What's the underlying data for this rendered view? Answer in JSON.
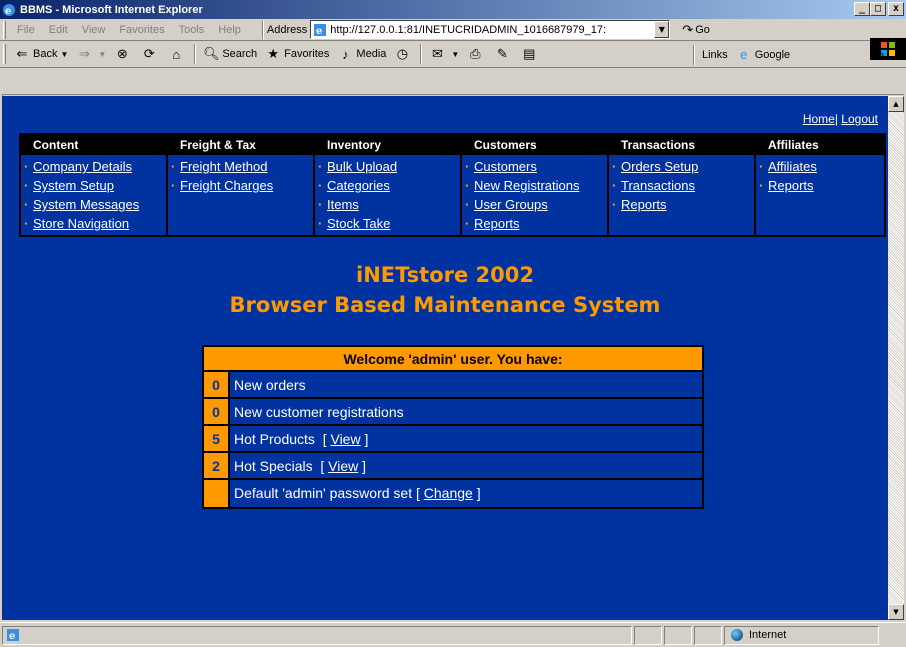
{
  "window": {
    "title": "BBMS - Microsoft Internet Explorer"
  },
  "menu": [
    "File",
    "Edit",
    "View",
    "Favorites",
    "Tools",
    "Help"
  ],
  "address": {
    "label": "Address",
    "url": "http://127.0.0.1:81/INETUCRIDADMIN_1016687979_17:"
  },
  "go_label": "Go",
  "toolbar": {
    "back": "Back",
    "search": "Search",
    "favorites": "Favorites",
    "media": "Media",
    "links": "Links",
    "google": "Google"
  },
  "toplinks": {
    "home": "Home",
    "logout": "Logout"
  },
  "nav": [
    {
      "heading": "Content",
      "items": [
        "Company Details",
        "System Setup",
        "System Messages",
        "Store Navigation"
      ]
    },
    {
      "heading": "Freight & Tax",
      "items": [
        "Freight Method",
        "Freight Charges"
      ]
    },
    {
      "heading": "Inventory",
      "items": [
        "Bulk Upload",
        "Categories",
        "Items",
        "Stock Take"
      ]
    },
    {
      "heading": "Customers",
      "items": [
        "Customers",
        "New Registrations",
        "User Groups",
        "Reports"
      ]
    },
    {
      "heading": "Transactions",
      "items": [
        "Orders Setup",
        "Transactions",
        "Reports"
      ]
    },
    {
      "heading": "Affiliates",
      "items": [
        "Affiliates",
        "Reports"
      ]
    }
  ],
  "heading": {
    "line1": "iNETstore 2002",
    "line2": "Browser Based Maintenance System"
  },
  "welcome": {
    "title": "Welcome 'admin' user. You have:",
    "rows": [
      {
        "count": "0",
        "text": "New orders",
        "link": ""
      },
      {
        "count": "0",
        "text": "New customer registrations",
        "link": ""
      },
      {
        "count": "5",
        "text": "Hot Products  [",
        "link": "View",
        "suffix": "]"
      },
      {
        "count": "2",
        "text": "Hot Specials  [",
        "link": "View",
        "suffix": "]"
      },
      {
        "count": "",
        "text": "Default 'admin' password set [",
        "link": "Change",
        "suffix": "]"
      }
    ]
  },
  "status": {
    "zone": "Internet"
  },
  "colors": {
    "page_bg": "#0033a0",
    "accent": "#ff9900",
    "header_bg": "#000000",
    "link": "#ffffff"
  }
}
